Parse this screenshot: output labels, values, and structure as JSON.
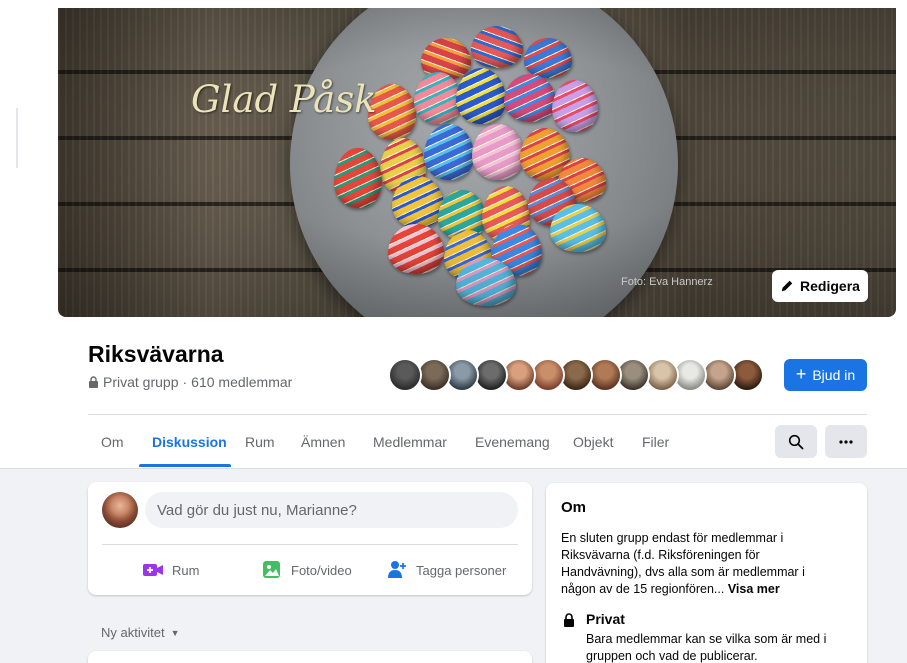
{
  "cover": {
    "title": "Glad Påsk",
    "photo_credit": "Foto: Eva Hannerz",
    "edit_label": "Redigera"
  },
  "group": {
    "name": "Riksvävarna",
    "privacy": "Privat grupp",
    "member_count": "610 medlemmar",
    "member_avatar_count": 13,
    "invite_label": "Bjud in"
  },
  "tabs": [
    {
      "label": "Om",
      "active": false
    },
    {
      "label": "Diskussion",
      "active": true
    },
    {
      "label": "Rum",
      "active": false
    },
    {
      "label": "Ämnen",
      "active": false
    },
    {
      "label": "Medlemmar",
      "active": false
    },
    {
      "label": "Evenemang",
      "active": false
    },
    {
      "label": "Objekt",
      "active": false
    },
    {
      "label": "Filer",
      "active": false
    }
  ],
  "tab_icons": [
    "search-icon",
    "more-icon"
  ],
  "composer": {
    "placeholder": "Vad gör du just nu, Marianne?",
    "actions": [
      {
        "label": "Rum",
        "icon": "video-plus-icon",
        "color": "#9a36e3"
      },
      {
        "label": "Foto/video",
        "icon": "photo-icon",
        "color": "#45bd62"
      },
      {
        "label": "Tagga personer",
        "icon": "tag-people-icon",
        "color": "#1b74e4"
      }
    ]
  },
  "feed": {
    "sort_label": "Ny aktivitet"
  },
  "about": {
    "title": "Om",
    "description": "En sluten grupp endast för medlemmar i Riksvävarna (f.d. Riksföreningen för Handvävning), dvs alla som är medlemmar i någon av de 15 regionfören...",
    "see_more": "Visa mer",
    "privacy_title": "Privat",
    "privacy_desc": "Bara medlemmar kan se vilka som är med i gruppen och vad de publicerar."
  },
  "colors": {
    "accent": "#1b74e4",
    "page_bg": "#f0f2f5",
    "text_secondary": "#65676b"
  }
}
